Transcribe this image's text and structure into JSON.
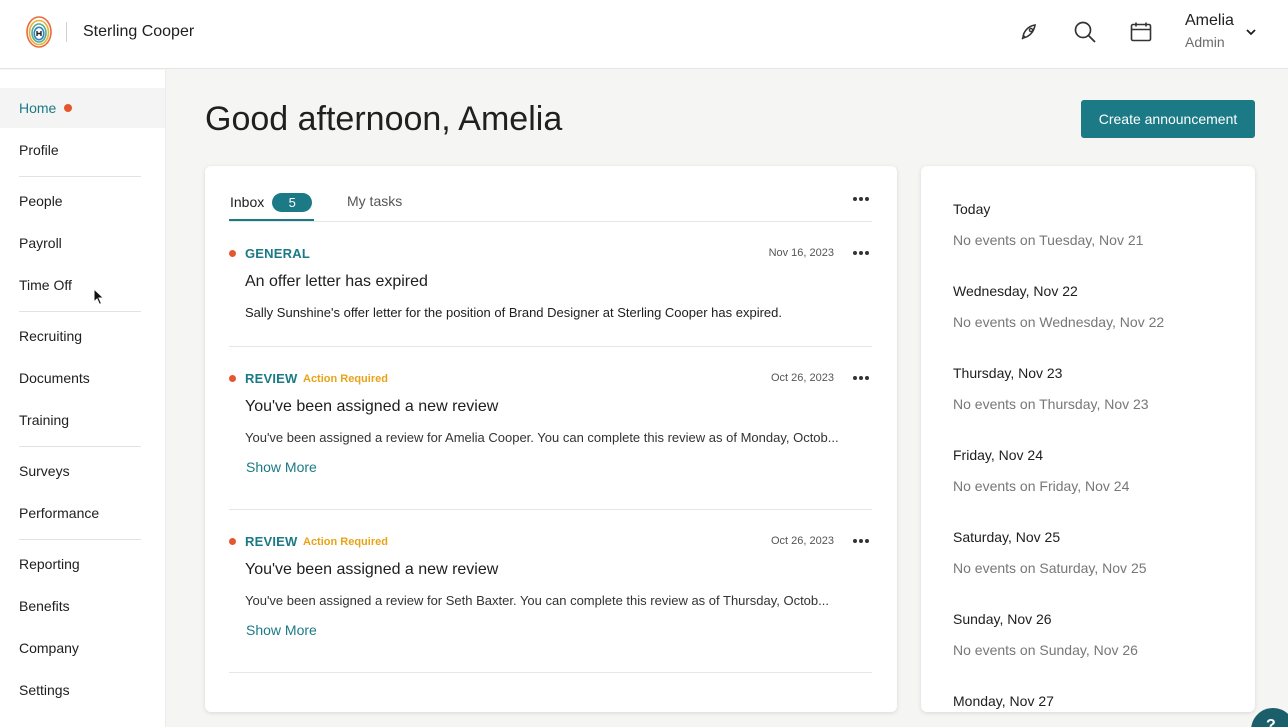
{
  "header": {
    "company": "Sterling Cooper",
    "user_name": "Amelia",
    "user_role": "Admin"
  },
  "sidebar": {
    "items": [
      {
        "label": "Home"
      },
      {
        "label": "Profile"
      },
      {
        "label": "People"
      },
      {
        "label": "Payroll"
      },
      {
        "label": "Time Off"
      },
      {
        "label": "Recruiting"
      },
      {
        "label": "Documents"
      },
      {
        "label": "Training"
      },
      {
        "label": "Surveys"
      },
      {
        "label": "Performance"
      },
      {
        "label": "Reporting"
      },
      {
        "label": "Benefits"
      },
      {
        "label": "Company"
      },
      {
        "label": "Settings"
      }
    ]
  },
  "main": {
    "greeting": "Good afternoon, Amelia",
    "create_label": "Create announcement"
  },
  "inbox": {
    "tab_inbox": "Inbox",
    "count": "5",
    "tab_tasks": "My tasks",
    "items": [
      {
        "category": "GENERAL",
        "date": "Nov 16, 2023",
        "title": "An offer letter has expired",
        "desc": "Sally Sunshine's offer letter for the position of Brand Designer at Sterling Cooper has expired."
      },
      {
        "category": "REVIEW",
        "badge": "Action Required",
        "date": "Oct 26, 2023",
        "title": "You've been assigned a new review",
        "desc": "You've been assigned a review for Amelia Cooper. You can complete this review as of Monday, Octob...",
        "more": "Show More"
      },
      {
        "category": "REVIEW",
        "badge": "Action Required",
        "date": "Oct 26, 2023",
        "title": "You've been assigned a new review",
        "desc": "You've been assigned a review for Seth Baxter. You can complete this review as of Thursday, Octob...",
        "more": "Show More"
      }
    ]
  },
  "calendar": {
    "days": [
      {
        "day": "Today",
        "empty": "No events on Tuesday, Nov 21"
      },
      {
        "day": "Wednesday, Nov 22",
        "empty": "No events on Wednesday, Nov 22"
      },
      {
        "day": "Thursday, Nov 23",
        "empty": "No events on Thursday, Nov 23"
      },
      {
        "day": "Friday, Nov 24",
        "empty": "No events on Friday, Nov 24"
      },
      {
        "day": "Saturday, Nov 25",
        "empty": "No events on Saturday, Nov 25"
      },
      {
        "day": "Sunday, Nov 26",
        "empty": "No events on Sunday, Nov 26"
      },
      {
        "day": "Monday, Nov 27"
      }
    ]
  },
  "colors": {
    "accent": "#1b7a86",
    "alert_dot": "#e4572e",
    "badge_text": "#e8a317"
  },
  "icons": [
    "logo-icon",
    "rocket-icon",
    "search-icon",
    "calendar-icon",
    "chevron-down-icon",
    "more-icon",
    "help-icon"
  ]
}
